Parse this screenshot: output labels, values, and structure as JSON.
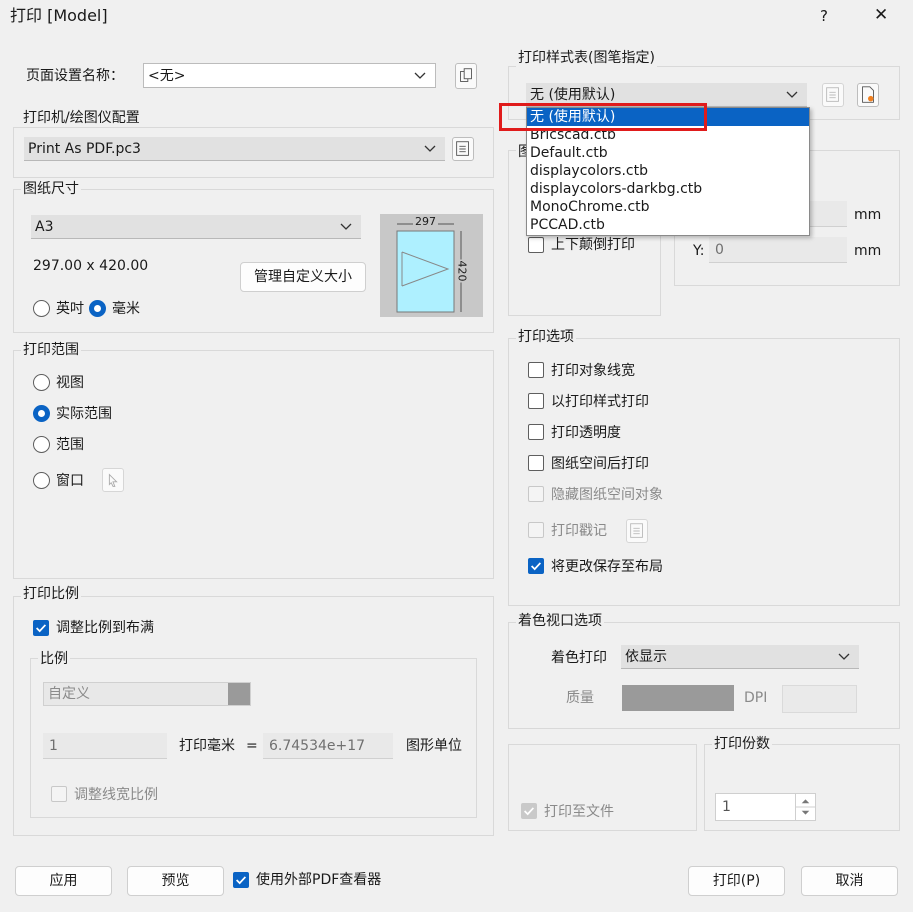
{
  "window": {
    "title": "打印 [Model]",
    "help": "?",
    "close": "✕"
  },
  "page_setup": {
    "label": "页面设置名称：",
    "value": "<无>"
  },
  "printer": {
    "title": "打印机/绘图仪配置",
    "value": "Print As PDF.pc3"
  },
  "paper": {
    "title": "图纸尺寸",
    "value": "A3",
    "size_text": "297.00 x 420.00",
    "manage_btn": "管理自定义大小",
    "unit_inch": "英吋",
    "unit_mm": "毫米",
    "preview_w": "297",
    "preview_h": "420"
  },
  "range": {
    "title": "打印范围",
    "options": [
      "视图",
      "实际范围",
      "范围",
      "窗口"
    ]
  },
  "scale": {
    "title": "打印比例",
    "fit_label": "调整比例到布满",
    "sub_title": "比例",
    "scale_value": "自定义",
    "val1": "1",
    "mm_label": "打印毫米",
    "eq": "=",
    "val2": "6.74534e+17",
    "units_label": "图形单位",
    "lineweight_label": "调整线宽比例"
  },
  "style_table": {
    "title": "打印样式表(图笔指定)",
    "value": "无 (使用默认)",
    "options": [
      "无 (使用默认)",
      "Bricscad.ctb",
      "Default.ctb",
      "displaycolors.ctb",
      "displaycolors-darkbg.ctb",
      "MonoChrome.ctb",
      "PCCAD.ctb"
    ]
  },
  "orientation": {
    "title_partial": "图",
    "upside_down": "上下颠倒打印"
  },
  "offset": {
    "mm1": "mm",
    "y_label": "Y:",
    "y_value": "0",
    "mm2": "mm"
  },
  "options": {
    "title": "打印选项",
    "items": [
      "打印对象线宽",
      "以打印样式打印",
      "打印透明度",
      "图纸空间后打印",
      "隐藏图纸空间对象",
      "打印戳记",
      "将更改保存至布局"
    ]
  },
  "shaded": {
    "title": "着色视口选项",
    "shade_label": "着色打印",
    "shade_value": "依显示",
    "quality_label": "质量",
    "dpi_label": "DPI"
  },
  "print_to_file": {
    "label": "打印至文件"
  },
  "copies": {
    "title": "打印份数",
    "value": "1"
  },
  "footer": {
    "apply": "应用",
    "preview": "预览",
    "external_pdf": "使用外部PDF查看器",
    "print": "打印(P)",
    "cancel": "取消"
  },
  "colors": {
    "accent": "#0a63c4",
    "highlight_box": "#e01b1b"
  }
}
